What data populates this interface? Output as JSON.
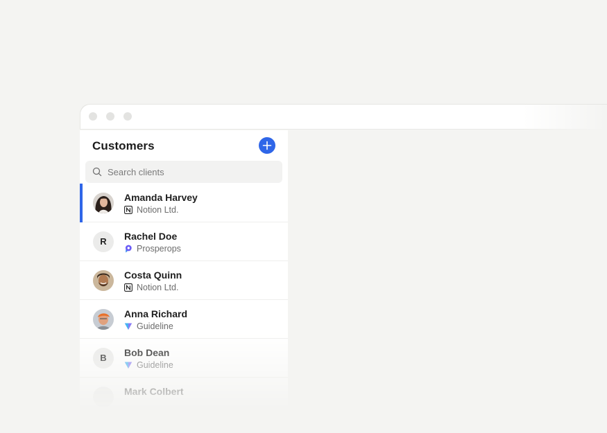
{
  "sidebar": {
    "title": "Customers",
    "add_icon": "plus-icon",
    "search": {
      "placeholder": "Search clients",
      "icon": "search-icon"
    },
    "customers": [
      {
        "name": "Amanda Harvey",
        "company": "Notion Ltd.",
        "company_icon": "notion-logo-icon",
        "avatar": "photo",
        "selected": true
      },
      {
        "name": "Rachel Doe",
        "company": "Prosperops",
        "company_icon": "prosperops-logo-icon",
        "avatar": "initial",
        "initial": "R",
        "selected": false
      },
      {
        "name": "Costa Quinn",
        "company": "Notion Ltd.",
        "company_icon": "notion-logo-icon",
        "avatar": "photo",
        "selected": false
      },
      {
        "name": "Anna Richard",
        "company": "Guideline",
        "company_icon": "guideline-logo-icon",
        "avatar": "photo",
        "selected": false
      },
      {
        "name": "Bob Dean",
        "company": "Guideline",
        "company_icon": "guideline-logo-icon",
        "avatar": "initial",
        "initial": "B",
        "selected": false
      },
      {
        "name": "Mark Colbert",
        "company": "",
        "company_icon": "",
        "avatar": "photo",
        "selected": false
      }
    ]
  },
  "colors": {
    "accent": "#2f66e8",
    "background": "#f4f4f2",
    "panel": "#ffffff"
  }
}
